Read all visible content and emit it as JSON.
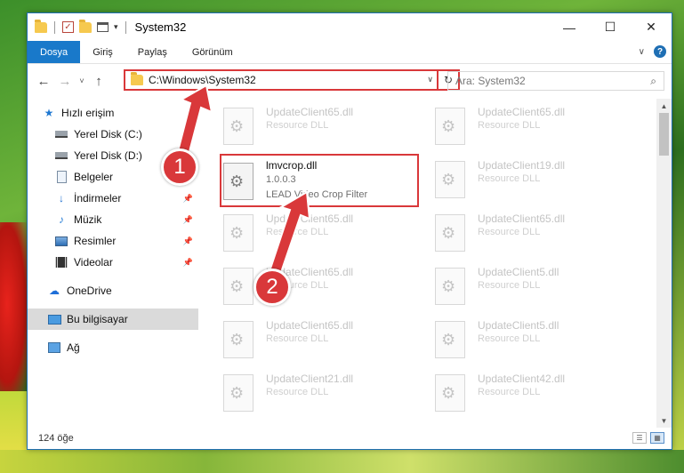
{
  "window": {
    "title": "System32",
    "min_glyph": "—",
    "max_glyph": "☐",
    "close_glyph": "✕"
  },
  "ribbon": {
    "tabs": [
      "Dosya",
      "Giriş",
      "Paylaş",
      "Görünüm"
    ],
    "expand_glyph": "∨",
    "help_glyph": "?"
  },
  "address": {
    "path": "C:\\Windows\\System32",
    "refresh_glyph": "↻",
    "search_placeholder": "Ara: System32",
    "search_glyph": "⌕"
  },
  "nav_buttons": {
    "back": "←",
    "forward": "→",
    "recent": "˅",
    "up": "↑"
  },
  "sidebar": {
    "items": [
      {
        "label": "Hızlı erişim",
        "icon": "star-icon"
      },
      {
        "label": "Yerel Disk (C:)",
        "icon": "disk-icon"
      },
      {
        "label": "Yerel Disk (D:)",
        "icon": "disk-icon"
      },
      {
        "label": "Belgeler",
        "icon": "document-icon"
      },
      {
        "label": "İndirmeler",
        "icon": "download-icon"
      },
      {
        "label": "Müzik",
        "icon": "music-icon"
      },
      {
        "label": "Resimler",
        "icon": "pictures-icon"
      },
      {
        "label": "Videolar",
        "icon": "video-icon"
      },
      {
        "label": "OneDrive",
        "icon": "cloud-icon"
      },
      {
        "label": "Bu bilgisayar",
        "icon": "computer-icon"
      },
      {
        "label": "Ağ",
        "icon": "network-icon"
      }
    ],
    "pin_glyph": "📌"
  },
  "files": {
    "highlighted": {
      "name": "lmvcrop.dll",
      "version": "1.0.0.3",
      "description": "LEAD Video Crop Filter"
    },
    "tiles": [
      {
        "name": "UpdateClient65.dll",
        "desc": "Resource DLL"
      },
      {
        "name": "UpdateClient65.dll",
        "desc": "Resource DLL"
      },
      {
        "name": "UpdateClient19.dll",
        "desc": "Resource DLL"
      },
      {
        "name": "UpdateClient65.dll",
        "desc": "Resource DLL"
      },
      {
        "name": "UpdateClient65.dll",
        "desc": "Resource DLL"
      },
      {
        "name": "UpdateClient65.dll",
        "desc": "Resource DLL"
      },
      {
        "name": "UpdateClient5.dll",
        "desc": "Resource DLL"
      },
      {
        "name": "UpdateClient65.dll",
        "desc": "Resource DLL"
      },
      {
        "name": "UpdateClient5.dll",
        "desc": "Resource DLL"
      },
      {
        "name": "UpdateClient21.dll",
        "desc": "Resource DLL"
      },
      {
        "name": "UpdateClient42.dll",
        "desc": "Resource DLL"
      }
    ]
  },
  "scrollbar": {
    "up": "▲",
    "down": "▼"
  },
  "status": {
    "count": "124 öğe",
    "details_glyph": "☰",
    "tiles_glyph": "▦"
  },
  "callouts": {
    "one": "1",
    "two": "2"
  },
  "colors": {
    "accent": "#1979ca",
    "callout": "#d9383a"
  }
}
